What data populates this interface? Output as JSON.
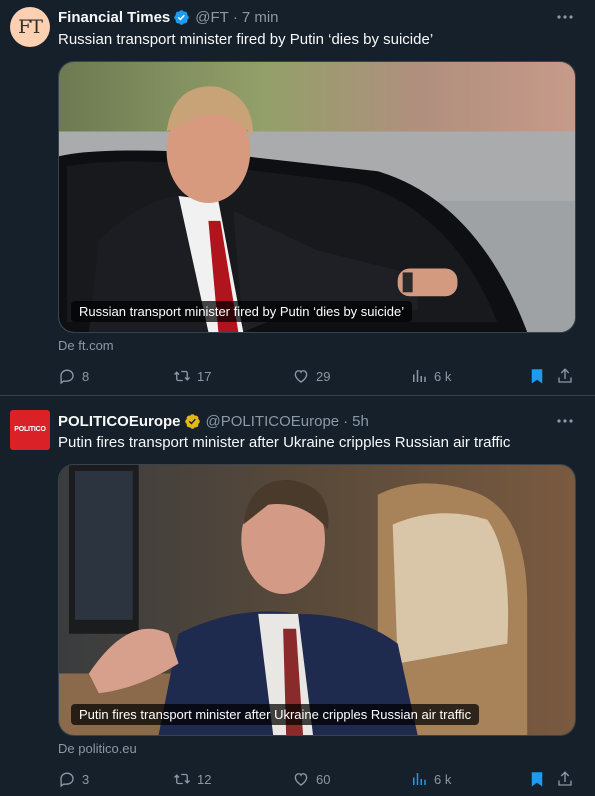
{
  "tweets": [
    {
      "avatar_text": "FT",
      "name": "Financial Times",
      "handle": "@FT",
      "separator": "·",
      "time": "7 min",
      "text": "Russian transport minister fired by Putin ‘dies by suicide’",
      "card_caption": "Russian transport minister fired by Putin ‘dies by suicide’",
      "source": "De ft.com",
      "replies": "8",
      "reposts": "17",
      "likes": "29",
      "views": "6 k",
      "verified_color": "#1d9bf0"
    },
    {
      "avatar_text": "POLITICO",
      "name": "POLITICOEurope",
      "handle": "@POLITICOEurope",
      "separator": "·",
      "time": "5h",
      "text": "Putin fires transport minister after Ukraine cripples Russian air traffic",
      "card_caption": "Putin fires transport minister after Ukraine cripples Russian air traffic",
      "source": "De politico.eu",
      "replies": "3",
      "reposts": "12",
      "likes": "60",
      "views": "6 k",
      "verified_color": "#e2b719"
    }
  ],
  "colors": {
    "background": "#15202b",
    "muted_text": "#8b98a5",
    "primary_text": "#f7f9f9",
    "bookmark_active": "#1d9bf0",
    "divider": "#38444d"
  },
  "icons": [
    "verified-badge-icon",
    "more-icon",
    "reply-icon",
    "repost-icon",
    "like-icon",
    "views-icon",
    "bookmark-icon",
    "share-icon"
  ]
}
